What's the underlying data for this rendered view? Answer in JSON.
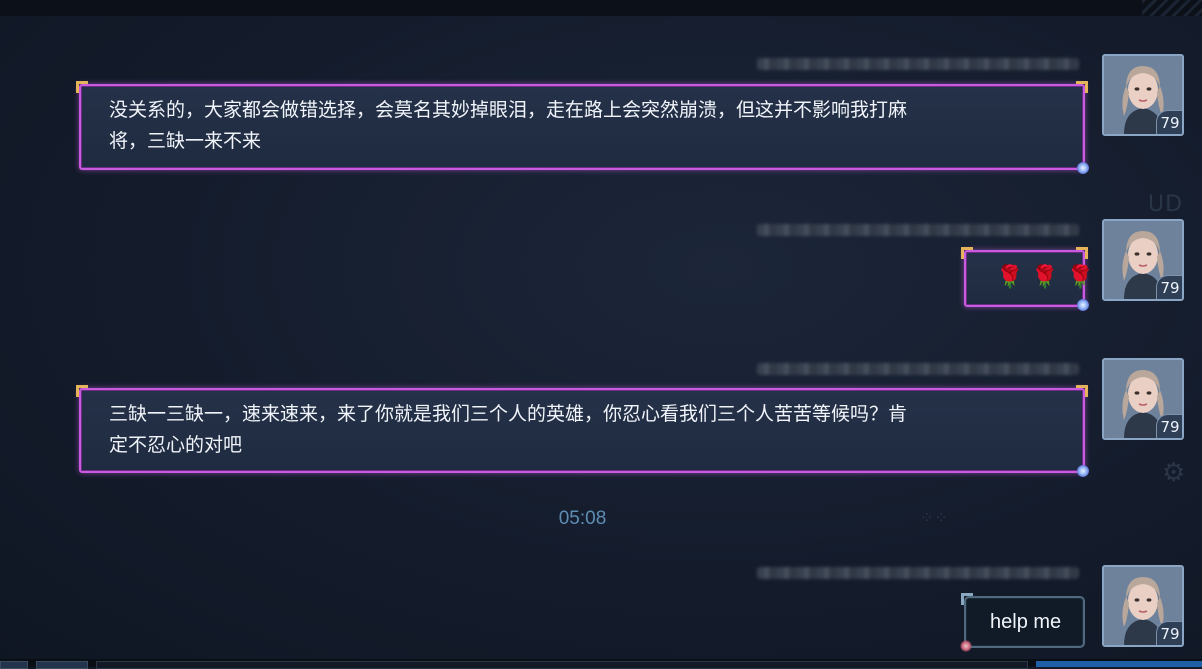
{
  "chat": {
    "messages": [
      {
        "type": "text",
        "text": "没关系的，大家都会做错选择，会莫名其妙掉眼泪，走在路上会突然崩溃，但这并不影响我打麻\n将，三缺一来不来",
        "level": "79"
      },
      {
        "type": "emoji",
        "emojis": [
          "🌹",
          "🌹",
          "🌹"
        ],
        "level": "79"
      },
      {
        "type": "text",
        "text": "三缺一三缺一，速来速来，来了你就是我们三个人的英雄，你忍心看我们三个人苦苦等候吗？肯\n定不忍心的对吧",
        "level": "79"
      },
      {
        "type": "text",
        "text": "help me",
        "level": "79"
      }
    ],
    "timestamp": "05:08"
  },
  "colors": {
    "bubble_border": "#c85bdf",
    "bubble_bg": "#243148",
    "timestamp": "#5e8db4",
    "background": "#141c2c"
  }
}
